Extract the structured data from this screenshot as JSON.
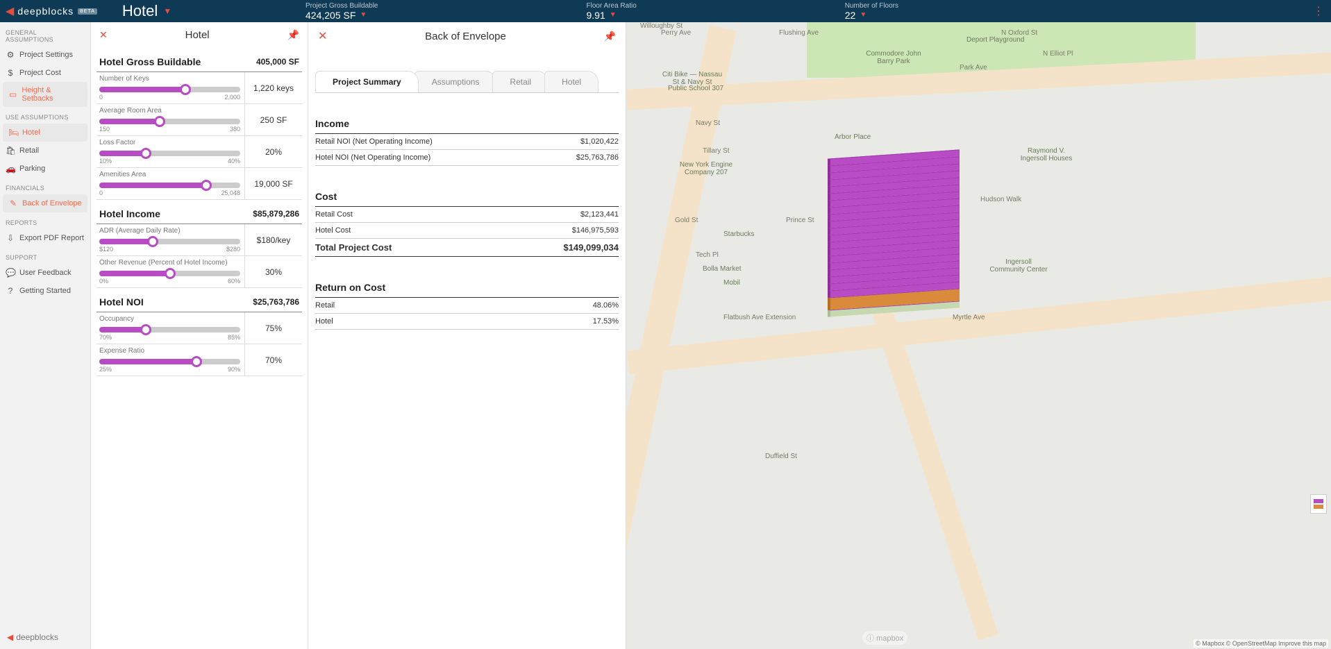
{
  "header": {
    "logo_text": "deepblocks",
    "logo_beta": "BETA",
    "project_name": "Hotel",
    "metrics": [
      {
        "label": "Project Gross Buildable",
        "value": "424,205 SF"
      },
      {
        "label": "Floor Area Ratio",
        "value": "9.91"
      },
      {
        "label": "Number of Floors",
        "value": "22"
      }
    ]
  },
  "sidebar": {
    "general_title": "GENERAL ASSUMPTIONS",
    "general": [
      {
        "icon": "⚙",
        "label": "Project Settings"
      },
      {
        "icon": "$",
        "label": "Project Cost"
      },
      {
        "icon": "▭",
        "label": "Height & Setbacks"
      }
    ],
    "use_title": "USE ASSUMPTIONS",
    "use": [
      {
        "icon": "🛏",
        "label": "Hotel"
      },
      {
        "icon": "🛍",
        "label": "Retail"
      },
      {
        "icon": "🚗",
        "label": "Parking"
      }
    ],
    "fin_title": "FINANCIALS",
    "fin": [
      {
        "icon": "✎",
        "label": "Back of Envelope"
      }
    ],
    "rep_title": "REPORTS",
    "rep": [
      {
        "icon": "⇩",
        "label": "Export PDF Report"
      }
    ],
    "sup_title": "SUPPORT",
    "sup": [
      {
        "icon": "💬",
        "label": "User Feedback"
      },
      {
        "icon": "?",
        "label": "Getting Started"
      }
    ],
    "footer_logo": "deepblocks"
  },
  "hotel_panel": {
    "title": "Hotel",
    "sections": [
      {
        "name": "Hotel Gross Buildable",
        "value": "405,000 SF",
        "sliders": [
          {
            "label": "Number of Keys",
            "min": "0",
            "max": "2,000",
            "value": "1,220 keys",
            "pct": 61
          },
          {
            "label": "Average Room Area",
            "min": "150",
            "max": "380",
            "value": "250 SF",
            "pct": 43
          },
          {
            "label": "Loss Factor",
            "min": "10%",
            "max": "40%",
            "value": "20%",
            "pct": 33
          },
          {
            "label": "Amenities Area",
            "min": "0",
            "max": "25,048",
            "value": "19,000 SF",
            "pct": 76
          }
        ]
      },
      {
        "name": "Hotel Income",
        "value": "$85,879,286",
        "sliders": [
          {
            "label": "ADR (Average Daily Rate)",
            "min": "$120",
            "max": "$280",
            "value": "$180/key",
            "pct": 38
          },
          {
            "label": "Other Revenue (Percent of Hotel Income)",
            "min": "0%",
            "max": "60%",
            "value": "30%",
            "pct": 50
          }
        ]
      },
      {
        "name": "Hotel NOI",
        "value": "$25,763,786",
        "sliders": [
          {
            "label": "Occupancy",
            "min": "70%",
            "max": "85%",
            "value": "75%",
            "pct": 33
          },
          {
            "label": "Expense Ratio",
            "min": "25%",
            "max": "90%",
            "value": "70%",
            "pct": 69
          }
        ]
      }
    ]
  },
  "boe": {
    "title": "Back of Envelope",
    "tabs": [
      "Project Summary",
      "Assumptions",
      "Retail",
      "Hotel"
    ],
    "active_tab": 0,
    "income_title": "Income",
    "income_rows": [
      {
        "label": "Retail NOI (Net Operating Income)",
        "value": "$1,020,422"
      },
      {
        "label": "Hotel NOI (Net Operating Income)",
        "value": "$25,763,786"
      }
    ],
    "cost_title": "Cost",
    "cost_rows": [
      {
        "label": "Retail Cost",
        "value": "$2,123,441"
      },
      {
        "label": "Hotel Cost",
        "value": "$146,975,593"
      }
    ],
    "total_label": "Total Project Cost",
    "total_value": "$149,099,034",
    "roc_title": "Return on Cost",
    "roc_rows": [
      {
        "label": "Retail",
        "value": "48.06%"
      },
      {
        "label": "Hotel",
        "value": "17.53%"
      }
    ]
  },
  "map": {
    "roads": [
      "Flushing Ave",
      "Park Ave",
      "Tillary St",
      "Myrtle Ave",
      "Gold St",
      "Flatbush Ave Extension",
      "Prince St",
      "Navy St",
      "Duffield St",
      "Hudson Walk",
      "Tech Pl",
      "N Elliot Pl",
      "Willoughby St",
      "N Oxford St",
      "Perry Ave"
    ],
    "pois": [
      "Commodore John Barry Park",
      "New York Engine Company 207",
      "Starbucks",
      "Bolla Market",
      "Mobil",
      "Arbor Place",
      "Ingersoll Community Center",
      "Raymond V. Ingersoll Houses",
      "Citi Bike — Nassau St & Navy St",
      "Public School 307",
      "Deport Playground"
    ],
    "logo": "ⓘ mapbox",
    "attrib": "© Mapbox © OpenStreetMap Improve this map",
    "legend_colors": [
      "#b74cc4",
      "#d98a3a"
    ]
  }
}
